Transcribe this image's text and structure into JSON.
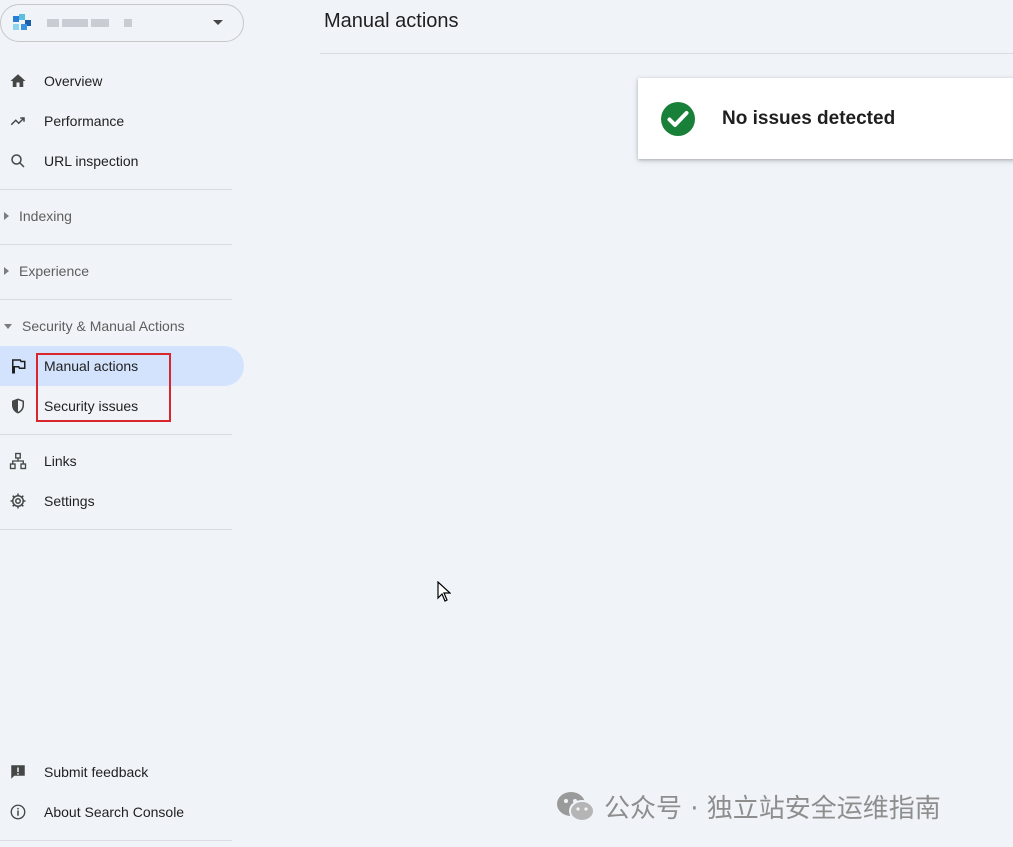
{
  "main": {
    "title": "Manual actions",
    "status_text": "No issues detected"
  },
  "sidebar": {
    "items": {
      "overview": "Overview",
      "performance": "Performance",
      "url_inspection": "URL inspection",
      "manual_actions": "Manual actions",
      "security_issues": "Security issues",
      "links": "Links",
      "settings": "Settings",
      "submit_feedback": "Submit feedback",
      "about": "About Search Console"
    },
    "sections": {
      "indexing": "Indexing",
      "experience": "Experience",
      "security": "Security & Manual Actions"
    }
  },
  "watermark": {
    "text": "公众号 · 独立站安全运维指南"
  },
  "colors": {
    "background": "#f0f4f9",
    "active_item": "#d3e3fd",
    "success": "#188038",
    "highlight": "#d9262c"
  }
}
